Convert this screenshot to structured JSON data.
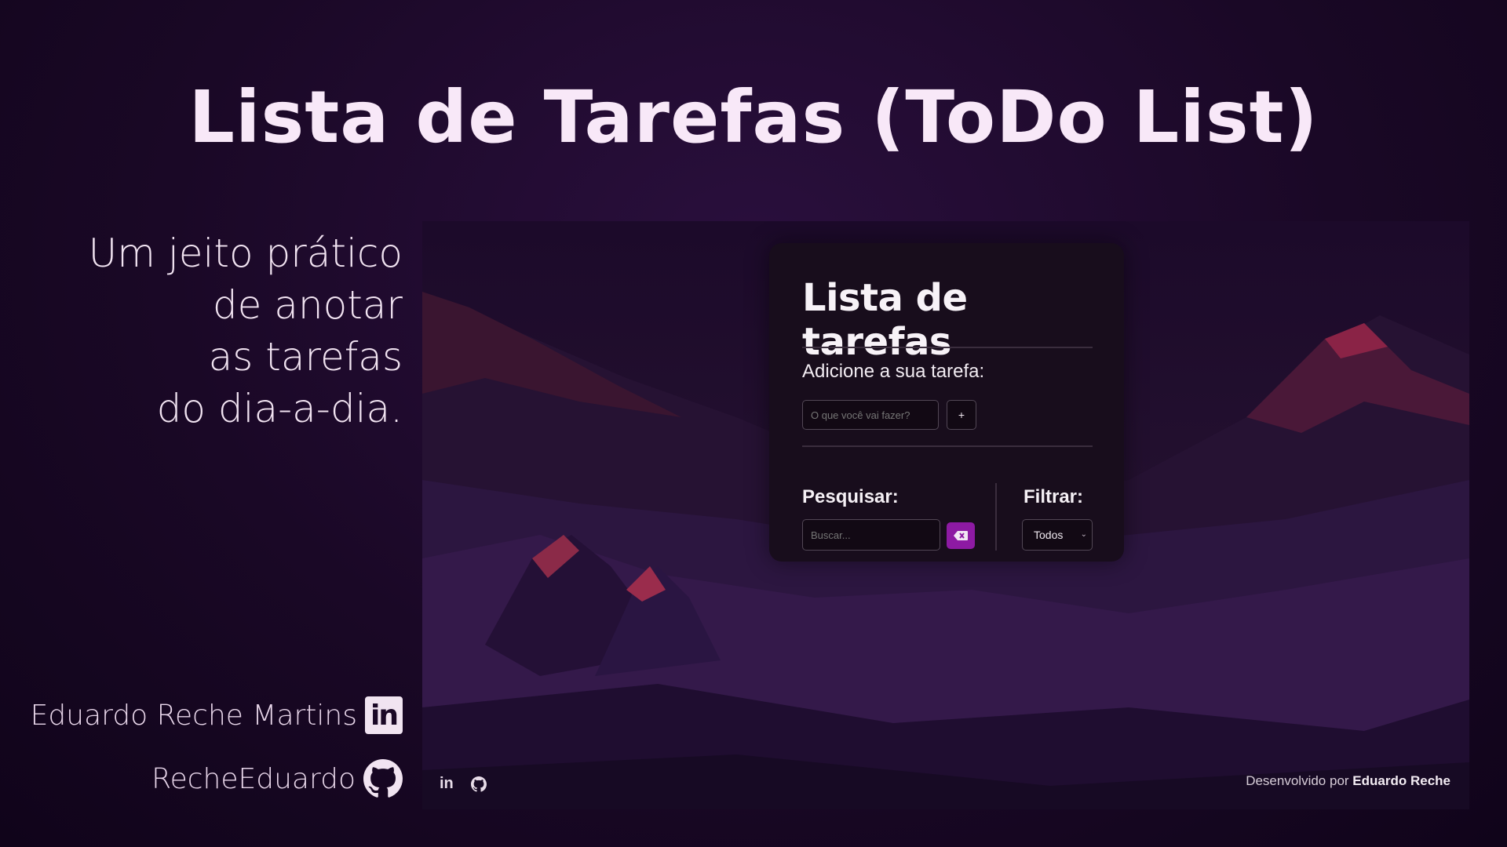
{
  "hero": {
    "title": "Lista de Tarefas (ToDo List)",
    "tagline": [
      "Um jeito prático",
      "de anotar",
      "as tarefas",
      "do dia-a-dia."
    ]
  },
  "author": {
    "name": "Eduardo Reche Martins",
    "linkedin_icon": "linkedin-icon",
    "github_user": "RecheEduardo",
    "github_icon": "github-icon"
  },
  "app": {
    "title": "Lista de tarefas",
    "add_label": "Adicione a sua tarefa:",
    "add_placeholder": "O que você vai fazer?",
    "add_button": "+",
    "search_label": "Pesquisar:",
    "search_placeholder": "Buscar...",
    "clear_icon": "backspace-icon",
    "filter_label": "Filtrar:",
    "filter_value": "Todos",
    "footer": {
      "credit_prefix": "Desenvolvido por",
      "credit_name": "Eduardo Reche"
    }
  },
  "colors": {
    "background": "#1a0826",
    "accent": "#8d1aa3",
    "card": "#180d1c"
  }
}
